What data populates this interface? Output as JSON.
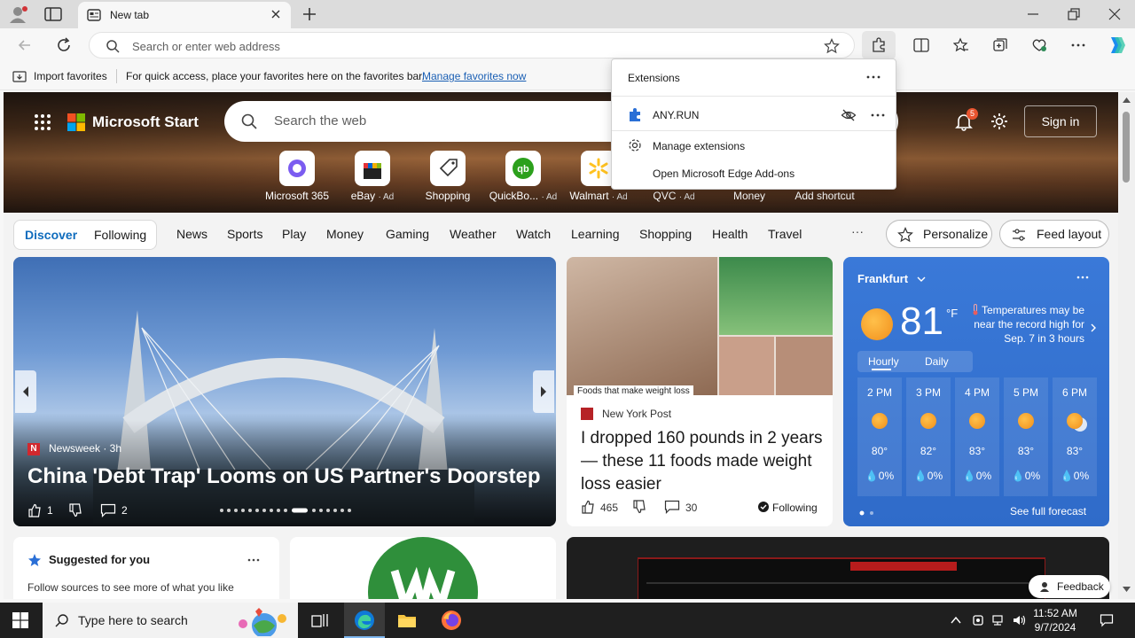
{
  "browser": {
    "tab_title": "New tab",
    "address_placeholder": "Search or enter web address"
  },
  "favorites_bar": {
    "import_label": "Import favorites",
    "message": "For quick access, place your favorites here on the favorites bar.",
    "manage_link": "Manage favorites now"
  },
  "extensions_popup": {
    "title": "Extensions",
    "items": [
      {
        "name": "ANY.RUN"
      }
    ],
    "manage": "Manage extensions",
    "addons": "Open Microsoft Edge Add-ons"
  },
  "msn": {
    "brand": "Microsoft Start",
    "search_placeholder": "Search the web",
    "notification_count": "5",
    "sign_in": "Sign in",
    "shortcuts": [
      {
        "label": "Microsoft 365",
        "ad": ""
      },
      {
        "label": "eBay",
        "ad": "· Ad"
      },
      {
        "label": "Shopping",
        "ad": ""
      },
      {
        "label": "QuickBo...",
        "ad": "· Ad"
      },
      {
        "label": "Walmart",
        "ad": "· Ad"
      },
      {
        "label": "QVC",
        "ad": "· Ad"
      },
      {
        "label": "Money",
        "ad": ""
      },
      {
        "label": "Add shortcut",
        "ad": ""
      }
    ],
    "feed_tabs": [
      "Discover",
      "Following"
    ],
    "nav_links": [
      "News",
      "Sports",
      "Play",
      "Money",
      "Gaming",
      "Weather",
      "Watch",
      "Learning",
      "Shopping",
      "Health",
      "Travel"
    ],
    "more": "···",
    "personalize": "Personalize",
    "feed_layout": "Feed layout"
  },
  "hero_story": {
    "source": "Newsweek · 3h",
    "source_letter": "N",
    "headline": "China 'Debt Trap' Looms on US Partner's Doorstep",
    "likes": "1",
    "comments": "2"
  },
  "news_story": {
    "image_caption": "Foods that make weight loss",
    "source": "New York Post",
    "headline": "I dropped 160 pounds in 2 years — these 11 foods made weight loss easier",
    "likes": "465",
    "comments": "30",
    "following": "Following"
  },
  "weather": {
    "city": "Frankfurt",
    "temp": "81",
    "unit": "°F",
    "alert": "Temperatures may be near the record high for Sep. 7 in 3 hours",
    "tabs": [
      "Hourly",
      "Daily"
    ],
    "hours": [
      {
        "time": "2 PM",
        "temp": "80°",
        "precip": "0%"
      },
      {
        "time": "3 PM",
        "temp": "82°",
        "precip": "0%"
      },
      {
        "time": "4 PM",
        "temp": "83°",
        "precip": "0%"
      },
      {
        "time": "5 PM",
        "temp": "83°",
        "precip": "0%"
      },
      {
        "time": "6 PM",
        "temp": "83°",
        "precip": "0%"
      }
    ],
    "forecast_link": "See full forecast"
  },
  "suggested": {
    "title": "Suggested for you",
    "subtitle": "Follow sources to see more of what you like"
  },
  "feedback": "Feedback",
  "taskbar": {
    "search_placeholder": "Type here to search",
    "time": "11:52 AM",
    "date": "9/7/2024"
  },
  "colors": {
    "accent": "#0f6cbd",
    "weather_bg": "#2f6bc9",
    "taskbar": "#1f1f1f"
  }
}
